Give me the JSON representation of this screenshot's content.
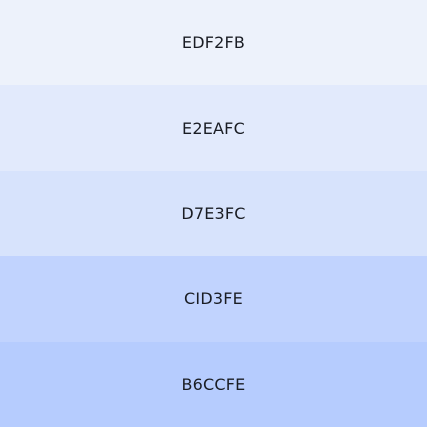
{
  "palette": {
    "swatches": [
      {
        "label": "EDF2FB",
        "color": "#EDF2FB"
      },
      {
        "label": "E2EAFC",
        "color": "#E2EAFC"
      },
      {
        "label": "D7E3FC",
        "color": "#D7E3FC"
      },
      {
        "label": "CID3FE",
        "color": "#C1D3FE"
      },
      {
        "label": "B6CCFE",
        "color": "#B6CCFE"
      }
    ]
  }
}
